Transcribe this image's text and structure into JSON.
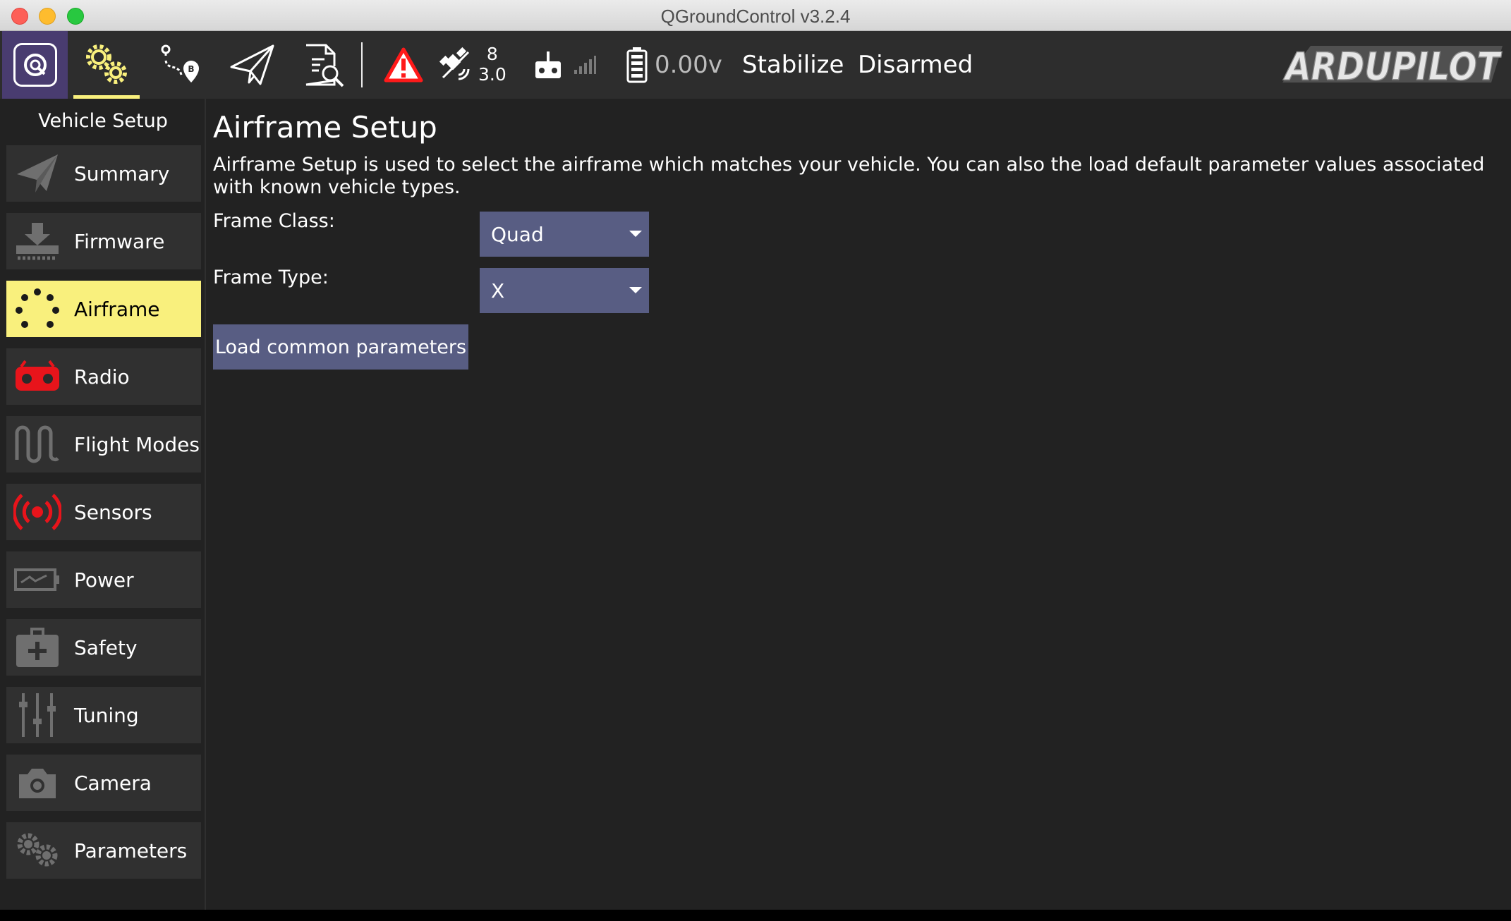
{
  "window": {
    "title": "QGroundControl v3.2.4"
  },
  "toolbar": {
    "items": [
      {
        "name": "qgc-logo-icon"
      },
      {
        "name": "vehicle-setup-gears-icon",
        "active": true
      },
      {
        "name": "plan-view-icon"
      },
      {
        "name": "fly-view-icon"
      },
      {
        "name": "analyze-icon"
      }
    ],
    "gps": {
      "satellite_count": "8",
      "hdop": "3.0"
    },
    "battery": {
      "voltage": "0.00v"
    },
    "flight_mode": "Stabilize",
    "arm_state": "Disarmed",
    "brand": "ARDUPILOT",
    "colors": {
      "toolbar_bg": "#2d2d2d",
      "logo_bg": "#493c70",
      "accent": "#f9f07d",
      "warning": "#ff1a1a"
    }
  },
  "sidebar": {
    "heading": "Vehicle Setup",
    "items": [
      {
        "label": "Summary",
        "icon": "paper-plane-icon",
        "active": false
      },
      {
        "label": "Firmware",
        "icon": "download-icon",
        "active": false
      },
      {
        "label": "Airframe",
        "icon": "airframe-dots-icon",
        "active": true
      },
      {
        "label": "Radio",
        "icon": "radio-controller-icon",
        "active": false
      },
      {
        "label": "Flight Modes",
        "icon": "flight-modes-wave-icon",
        "active": false
      },
      {
        "label": "Sensors",
        "icon": "sensors-broadcast-icon",
        "active": false
      },
      {
        "label": "Power",
        "icon": "battery-power-icon",
        "active": false
      },
      {
        "label": "Safety",
        "icon": "first-aid-kit-icon",
        "active": false
      },
      {
        "label": "Tuning",
        "icon": "sliders-icon",
        "active": false
      },
      {
        "label": "Camera",
        "icon": "camera-icon",
        "active": false
      },
      {
        "label": "Parameters",
        "icon": "parameters-gears-icon",
        "active": false
      }
    ]
  },
  "main": {
    "title": "Airframe Setup",
    "description": "Airframe Setup is used to select the airframe which matches your vehicle. You can also the load default parameter values associated with known vehicle types.",
    "frame_class": {
      "label": "Frame Class:",
      "value": "Quad"
    },
    "frame_type": {
      "label": "Frame Type:",
      "value": "X"
    },
    "load_button": "Load common parameters"
  }
}
